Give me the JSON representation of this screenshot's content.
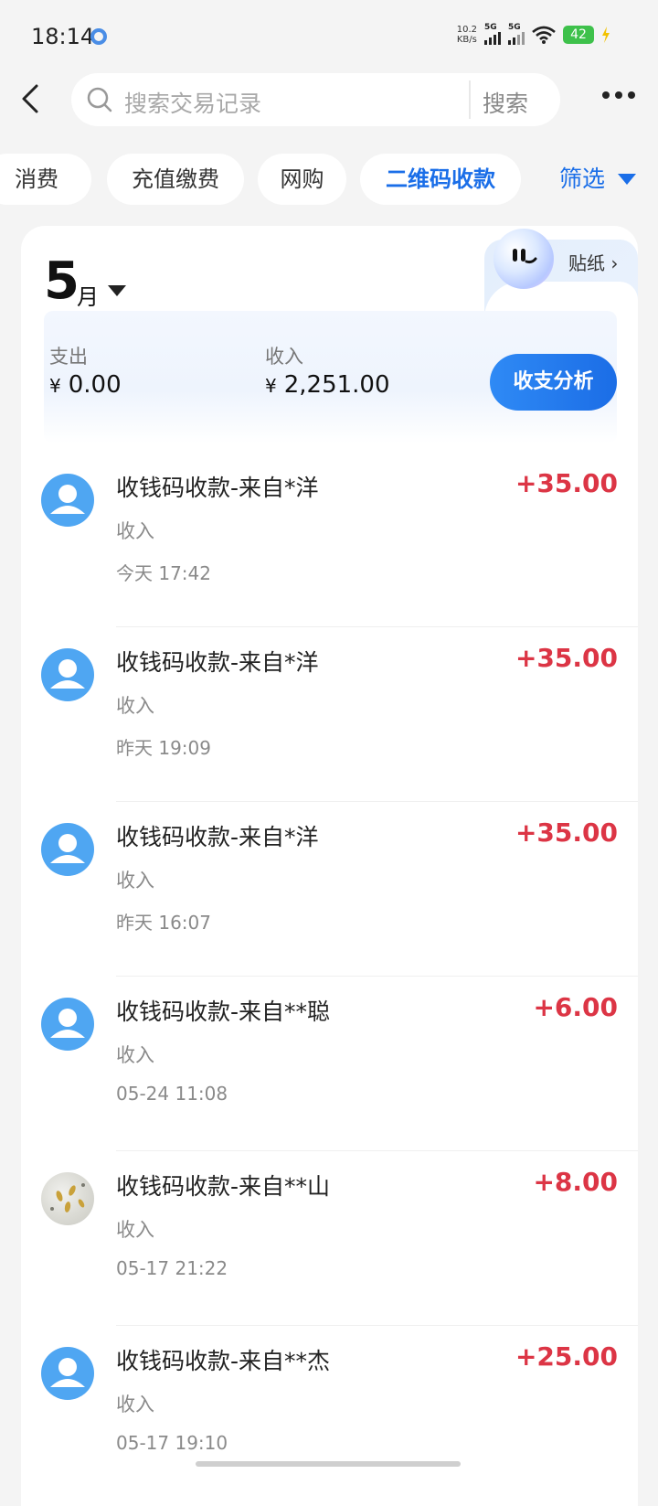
{
  "status_bar": {
    "time": "18:14",
    "net_speed": "10.2",
    "net_unit": "KB/s",
    "sim1": "5G",
    "sim2": "5G",
    "battery": "42"
  },
  "header": {
    "search_placeholder": "搜索交易记录",
    "search_button": "搜索"
  },
  "filter_chips": [
    {
      "label": "消费",
      "active": false
    },
    {
      "label": "充值缴费",
      "active": false
    },
    {
      "label": "网购",
      "active": false
    },
    {
      "label": "二维码收款",
      "active": true
    }
  ],
  "filter_label": "筛选",
  "summary": {
    "month_number": "5",
    "month_unit": "月",
    "sticker_label": "贴纸",
    "expense_label": "支出",
    "expense_currency": "¥",
    "expense_value": "0.00",
    "income_label": "收入",
    "income_currency": "¥",
    "income_value": "2,251.00",
    "analysis_button": "收支分析"
  },
  "transactions": [
    {
      "title": "收钱码收款-来自*洋",
      "type": "收入",
      "time": "今天 17:42",
      "amount": "+35.00",
      "avatar": "default"
    },
    {
      "title": "收钱码收款-来自*洋",
      "type": "收入",
      "time": "昨天 19:09",
      "amount": "+35.00",
      "avatar": "default"
    },
    {
      "title": "收钱码收款-来自*洋",
      "type": "收入",
      "time": "昨天 16:07",
      "amount": "+35.00",
      "avatar": "default"
    },
    {
      "title": "收钱码收款-来自**聪",
      "type": "收入",
      "time": "05-24 11:08",
      "amount": "+6.00",
      "avatar": "default"
    },
    {
      "title": "收钱码收款-来自**山",
      "type": "收入",
      "time": "05-17 21:22",
      "amount": "+8.00",
      "avatar": "photo"
    },
    {
      "title": "收钱码收款-来自**杰",
      "type": "收入",
      "time": "05-17 19:10",
      "amount": "+25.00",
      "avatar": "default"
    }
  ],
  "colors": {
    "accent": "#1a6ee8",
    "income_red": "#dc3545",
    "avatar_blue": "#4fa6f2",
    "background": "#f4f4f4"
  }
}
